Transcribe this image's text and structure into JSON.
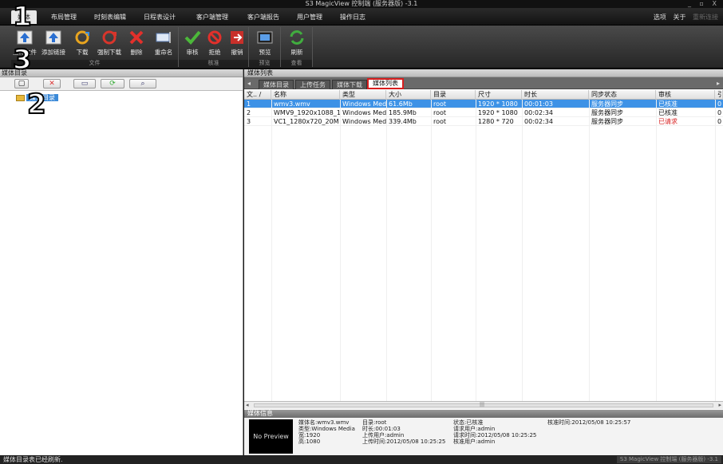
{
  "window": {
    "title": "S3 MagicView 控制端 (服务器版) -3.1",
    "controls": "_ ▫ X"
  },
  "menu": {
    "items": [
      "媒体",
      "布局管理",
      "时刻表编辑",
      "日程表设计",
      "客户端管理",
      "客户端报告",
      "用户管理",
      "操作日志"
    ],
    "right": {
      "options": "选项",
      "about": "关于",
      "reconnect": "重新连接"
    }
  },
  "ribbon": {
    "groups": [
      {
        "label": "文件",
        "buttons": [
          {
            "label": "上传文件",
            "icon": "upload-icon"
          },
          {
            "label": "添加链接",
            "icon": "add-link-icon"
          },
          {
            "label": "下载",
            "icon": "download-icon"
          },
          {
            "label": "强制下载",
            "icon": "force-download-icon"
          },
          {
            "label": "删除",
            "icon": "delete-icon"
          },
          {
            "label": "重命名",
            "icon": "rename-icon"
          }
        ]
      },
      {
        "label": "核准",
        "buttons": [
          {
            "label": "审核",
            "icon": "approve-icon"
          },
          {
            "label": "拒绝",
            "icon": "reject-icon"
          },
          {
            "label": "撤销",
            "icon": "revoke-icon"
          }
        ]
      },
      {
        "label": "预览",
        "buttons": [
          {
            "label": "预览",
            "icon": "preview-icon"
          }
        ]
      },
      {
        "label": "查看",
        "buttons": [
          {
            "label": "刷新",
            "icon": "refresh-icon"
          }
        ]
      }
    ]
  },
  "callouts": [
    "1",
    "3",
    "2"
  ],
  "left_panel": {
    "title": "媒体目录",
    "tree_root": "媒体目录"
  },
  "right_panel": {
    "title": "媒体列表",
    "tabs": [
      "媒体目录",
      "上传任务",
      "媒体下载",
      "媒体列表"
    ],
    "columns": [
      "文.. /",
      "名称",
      "类型",
      "大小",
      "目录",
      "尺寸",
      "时长",
      "同步状态",
      "审核",
      "引"
    ],
    "rows": [
      {
        "no": "1",
        "name": "wmv3.wmv",
        "type": "Windows Media",
        "size": "61.6Mb",
        "dir": "root",
        "dim": "1920 * 1080",
        "duration": "00:01:03",
        "sync": "服务器同步",
        "review": "已核准",
        "ref": "0",
        "selected": true
      },
      {
        "no": "2",
        "name": "WMV9_1920x1088_1",
        "type": "Windows Media",
        "size": "185.9Mb",
        "dir": "root",
        "dim": "1920 * 1080",
        "duration": "00:02:34",
        "sync": "服务器同步",
        "review": "已核准",
        "ref": "0",
        "selected": false
      },
      {
        "no": "3",
        "name": "VC1_1280x720_20M",
        "type": "Windows Media",
        "size": "339.4Mb",
        "dir": "root",
        "dim": "1280 * 720",
        "duration": "00:02:34",
        "sync": "服务器同步",
        "review": "已请求",
        "ref": "0",
        "selected": false
      }
    ]
  },
  "media_info": {
    "title": "媒体信息",
    "preview": "No Preview",
    "col1": [
      "媒体名:wmv3.wmv",
      "类型:Windows Media",
      "宽:1920",
      "高:1080"
    ],
    "col2": [
      "目录:root",
      "时长:00:01:03",
      "上传用户:admin",
      "上传时间:2012/05/08 10:25:25"
    ],
    "col3": [
      "状态:已核准",
      "请求用户:admin",
      "请求时间:2012/05/08 10:25:25",
      "核准用户:admin"
    ],
    "col4": [
      "核准时间:2012/05/08 10:25:57"
    ]
  },
  "status": {
    "text": "媒体目录表已经刷新.",
    "right": "S3 MagicView 控制端 (服务器版) -3.1"
  },
  "colors": {
    "selection": "#3d92e6",
    "highlight": "#d81e1e",
    "requested": "#d81e1e"
  }
}
